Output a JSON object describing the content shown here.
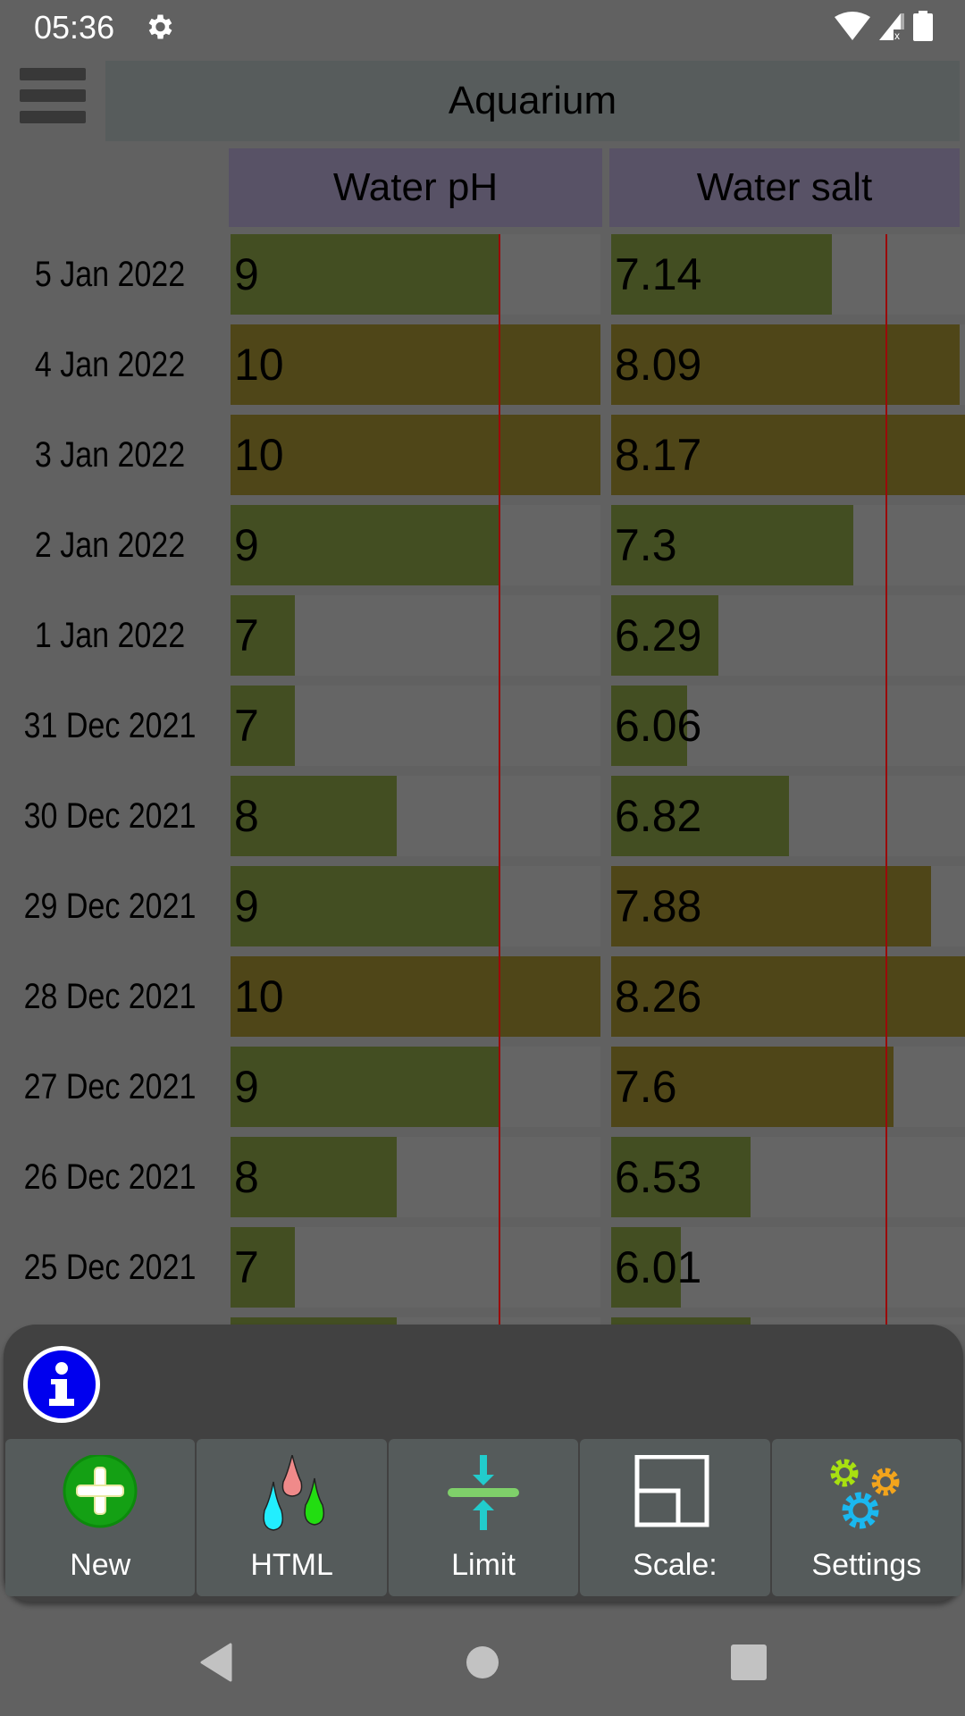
{
  "status_bar": {
    "time": "05:36",
    "icons": [
      "gear-icon",
      "wifi-icon",
      "signal-no-data-icon",
      "battery-icon"
    ]
  },
  "header": {
    "menu_icon": "hamburger-menu-icon",
    "title": "Aquarium"
  },
  "columns": [
    {
      "label": "Water pH",
      "scale_min": 6.37,
      "scale_max": 10,
      "limit": 9
    },
    {
      "label": "Water salt",
      "scale_min": 5.49,
      "scale_max": 8.2,
      "limit": 7.54
    }
  ],
  "colors": {
    "bar_ok": "#434e22",
    "bar_over": "#4f4618",
    "limit_line": "#9a0a0a",
    "column_header": "#585266",
    "info_blue": "#0000ee"
  },
  "rows": [
    {
      "date": "5 Jan 2022",
      "values": [
        "9",
        "7.14"
      ],
      "over": [
        false,
        false
      ]
    },
    {
      "date": "4 Jan 2022",
      "values": [
        "10",
        "8.09"
      ],
      "over": [
        true,
        true
      ]
    },
    {
      "date": "3 Jan 2022",
      "values": [
        "10",
        "8.17"
      ],
      "over": [
        true,
        true
      ]
    },
    {
      "date": "2 Jan 2022",
      "values": [
        "9",
        "7.3"
      ],
      "over": [
        false,
        false
      ]
    },
    {
      "date": "1 Jan 2022",
      "values": [
        "7",
        "6.29"
      ],
      "over": [
        false,
        false
      ]
    },
    {
      "date": "31 Dec 2021",
      "values": [
        "7",
        "6.06"
      ],
      "over": [
        false,
        false
      ]
    },
    {
      "date": "30 Dec 2021",
      "values": [
        "8",
        "6.82"
      ],
      "over": [
        false,
        false
      ]
    },
    {
      "date": "29 Dec 2021",
      "values": [
        "9",
        "7.88"
      ],
      "over": [
        false,
        true
      ]
    },
    {
      "date": "28 Dec 2021",
      "values": [
        "10",
        "8.26"
      ],
      "over": [
        true,
        true
      ]
    },
    {
      "date": "27 Dec 2021",
      "values": [
        "9",
        "7.6"
      ],
      "over": [
        false,
        true
      ]
    },
    {
      "date": "26 Dec 2021",
      "values": [
        "8",
        "6.53"
      ],
      "over": [
        false,
        false
      ]
    },
    {
      "date": "25 Dec 2021",
      "values": [
        "7",
        "6.01"
      ],
      "over": [
        false,
        false
      ]
    },
    {
      "date": "",
      "values": [
        "8",
        "6.53"
      ],
      "over": [
        false,
        false
      ]
    }
  ],
  "info_icon": "info-icon",
  "toolbar": [
    {
      "label": "New",
      "icon": "add-icon"
    },
    {
      "label": "HTML",
      "icon": "drops-icon"
    },
    {
      "label": "Limit",
      "icon": "limit-icon"
    },
    {
      "label": "Scale:",
      "icon": "scale-icon"
    },
    {
      "label": "Settings",
      "icon": "gears-icon"
    }
  ],
  "nav": [
    "back-icon",
    "home-icon",
    "recents-icon"
  ]
}
